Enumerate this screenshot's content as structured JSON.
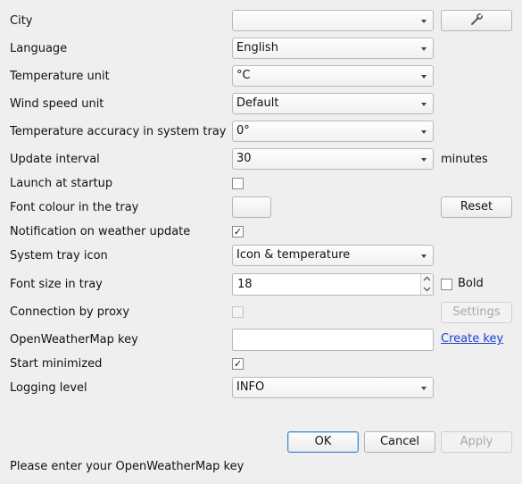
{
  "labels": {
    "city": "City",
    "language": "Language",
    "temperature_unit": "Temperature unit",
    "wind_speed_unit": "Wind speed unit",
    "temperature_accuracy": "Temperature accuracy in system tray",
    "update_interval": "Update interval",
    "launch_at_startup": "Launch at startup",
    "font_colour": "Font colour in the tray",
    "notification": "Notification on weather update",
    "system_tray_icon": "System tray icon",
    "font_size": "Font size in tray",
    "connection_proxy": "Connection by proxy",
    "owm_key": "OpenWeatherMap key",
    "start_minimized": "Start minimized",
    "logging_level": "Logging level"
  },
  "values": {
    "city": "",
    "language": "English",
    "temperature_unit": "°C",
    "wind_speed_unit": "Default",
    "temperature_accuracy": "0°",
    "update_interval": "30",
    "system_tray_icon": "Icon & temperature",
    "font_size": "18",
    "owm_key": "",
    "logging_level": "INFO"
  },
  "checks": {
    "launch_at_startup": false,
    "notification": true,
    "bold": false,
    "connection_proxy": false,
    "start_minimized": true,
    "check_mark": "✓"
  },
  "buttons": {
    "reset": "Reset",
    "bold_label": "Bold",
    "settings": "Settings",
    "create_key": "Create key",
    "ok": "OK",
    "cancel": "Cancel",
    "apply": "Apply"
  },
  "units": {
    "minutes": "minutes"
  },
  "status": "Please enter your OpenWeatherMap key",
  "icons": {
    "city_search": "wrench-icon"
  },
  "colors": {
    "link": "#1a3fd0",
    "default_button_border": "#4a86c8",
    "window_bg": "#efefef"
  }
}
